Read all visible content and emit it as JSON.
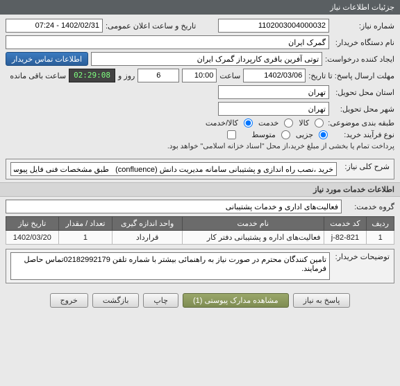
{
  "header": {
    "title": "جزئیات اطلاعات نیاز"
  },
  "labels": {
    "need_no": "شماره نیاز:",
    "public_announce": "تاریخ و ساعت اعلان عمومی:",
    "buyer_org": "نام دستگاه خریدار:",
    "requester": "ایجاد کننده درخواست:",
    "contact_info_btn": "اطلاعات تماس خریدار",
    "deadline": "مهلت ارسال پاسخ: تا تاریخ:",
    "hour": "ساعت",
    "and_day": "روز و",
    "remain": "ساعت باقی مانده",
    "province": "استان محل تحویل:",
    "city": "شهر محل تحویل:",
    "subject_class": "طبقه بندی موضوعی:",
    "process_type": "نوع فرآیند خرید:",
    "goods": "کالا",
    "service": "خدمت",
    "goods_service": "کالا/خدمت",
    "partial": "جزیی",
    "medium": "متوسط",
    "pay_note": "پرداخت تمام یا بخشی از مبلغ خرید،از محل \"اسناد خزانه اسلامی\" خواهد بود.",
    "need_title": "شرح کلی نیاز:",
    "services_section": "اطلاعات خدمات مورد نیاز",
    "service_group": "گروه خدمت:",
    "buyer_notes": "توضیحات خریدار:",
    "footer": {
      "respond": "پاسخ به نیاز",
      "view_docs": "مشاهده مدارک پیوستی (1)",
      "print": "چاپ",
      "back": "بازگشت",
      "exit": "خروج"
    }
  },
  "values": {
    "need_no": "1102003004000032",
    "public_announce": "1402/02/31 - 07:24",
    "buyer_org": "گمرک ایران",
    "requester": "توتی آفرین باقری کارپرداز گمرک ایران",
    "deadline_date": "1402/03/06",
    "deadline_hour": "10:00",
    "days": "6",
    "countdown": "02:29:08",
    "province": "تهران",
    "city": "تهران",
    "subject_radio": "goods_service",
    "process_radio": "partial",
    "pay_checked": false,
    "need_title": "خرید ،نصب راه اندازی و پشتیبانی سامانه مدیریت دانش (confluence)   طبق مشخصات فنی فایل پیوست",
    "service_group": "فعالیت‌های اداری و خدمات پشتیبانی",
    "buyer_notes": "تامین کنندگان محترم در صورت نیاز به راهنمائی بیشتر با شماره تلفن 02182992179تماس حاصل فرمایند."
  },
  "table": {
    "headers": {
      "row": "ردیف",
      "code": "کد خدمت",
      "name": "نام خدمت",
      "unit": "واحد اندازه گیری",
      "qty": "تعداد / مقدار",
      "date": "تاریخ نیاز"
    },
    "rows": [
      {
        "row": "1",
        "code": "j-82-821",
        "name": "فعالیت‌های اداره و پشتیبانی دفتر کار",
        "unit": "قرارداد",
        "qty": "1",
        "date": "1402/03/20"
      }
    ]
  }
}
